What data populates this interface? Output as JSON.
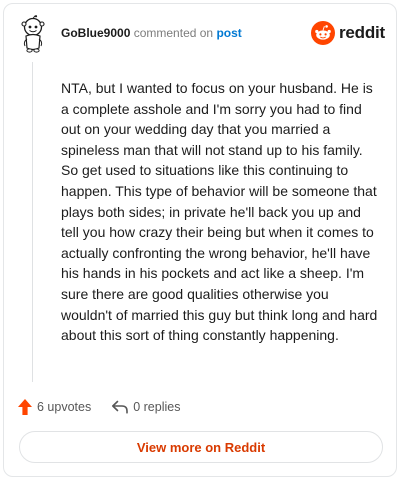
{
  "header": {
    "username": "GoBlue9000",
    "action_text": "commented on",
    "post_link": "post",
    "brand": "reddit"
  },
  "comment": {
    "body": "NTA, but I wanted to focus on your husband. He is a complete asshole and I'm sorry you had to find out on your wedding day that you married a spineless man that will not stand up to his family. So get used to situations like this continuing to happen. This type of behavior will be someone that plays both sides; in private he'll back you up and tell you how crazy their being but when it comes to actually confronting the wrong behavior, he'll have his hands in his pockets and act like a sheep. I'm sure there are good qualities otherwise you wouldn't of married this guy but think long and hard about this sort of thing constantly happening."
  },
  "actions": {
    "upvotes": "6 upvotes",
    "replies": "0 replies"
  },
  "footer": {
    "view_more": "View more on Reddit"
  },
  "icons": {
    "avatar": "snoo-avatar-icon",
    "brand_logo": "reddit-logo-icon",
    "upvote": "upvote-arrow-icon",
    "reply": "reply-arrow-icon"
  },
  "colors": {
    "brand": "#ff4500",
    "link": "#0079d3",
    "view_more": "#d93a00",
    "upvote": "#ff4500"
  }
}
